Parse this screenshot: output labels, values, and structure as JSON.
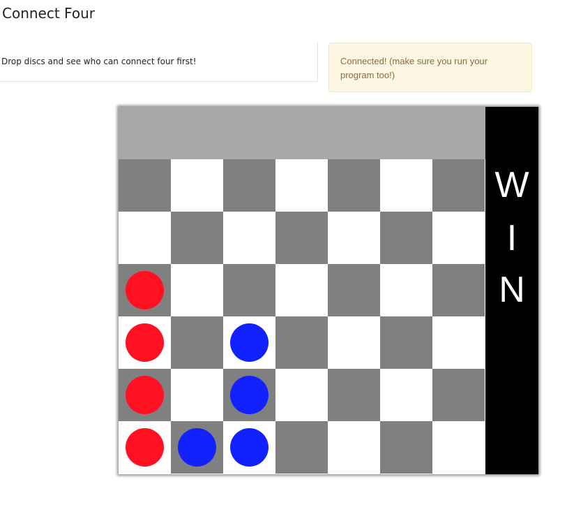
{
  "page": {
    "title": "Connect Four",
    "description": "Drop discs and see who can connect four first!"
  },
  "status": {
    "message": "Connected! (make sure you run your program too!)"
  },
  "colors": {
    "red_disc": "#ff1122",
    "blue_disc": "#1122ff",
    "dark_cell": "#808080",
    "light_cell": "#ffffff",
    "drop_row": "#a8a8a8",
    "win_panel": "#000000",
    "win_text": "#ffffff"
  },
  "board": {
    "columns": 7,
    "rows": 6,
    "grid": [
      [
        "",
        "",
        "",
        "",
        "",
        "",
        ""
      ],
      [
        "",
        "",
        "",
        "",
        "",
        "",
        ""
      ],
      [
        "red",
        "",
        "",
        "",
        "",
        "",
        ""
      ],
      [
        "red",
        "",
        "blue",
        "",
        "",
        "",
        ""
      ],
      [
        "red",
        "",
        "blue",
        "",
        "",
        "",
        ""
      ],
      [
        "red",
        "blue",
        "blue",
        "",
        "",
        "",
        ""
      ]
    ]
  },
  "win_banner": {
    "letters": [
      "W",
      "I",
      "N"
    ]
  }
}
